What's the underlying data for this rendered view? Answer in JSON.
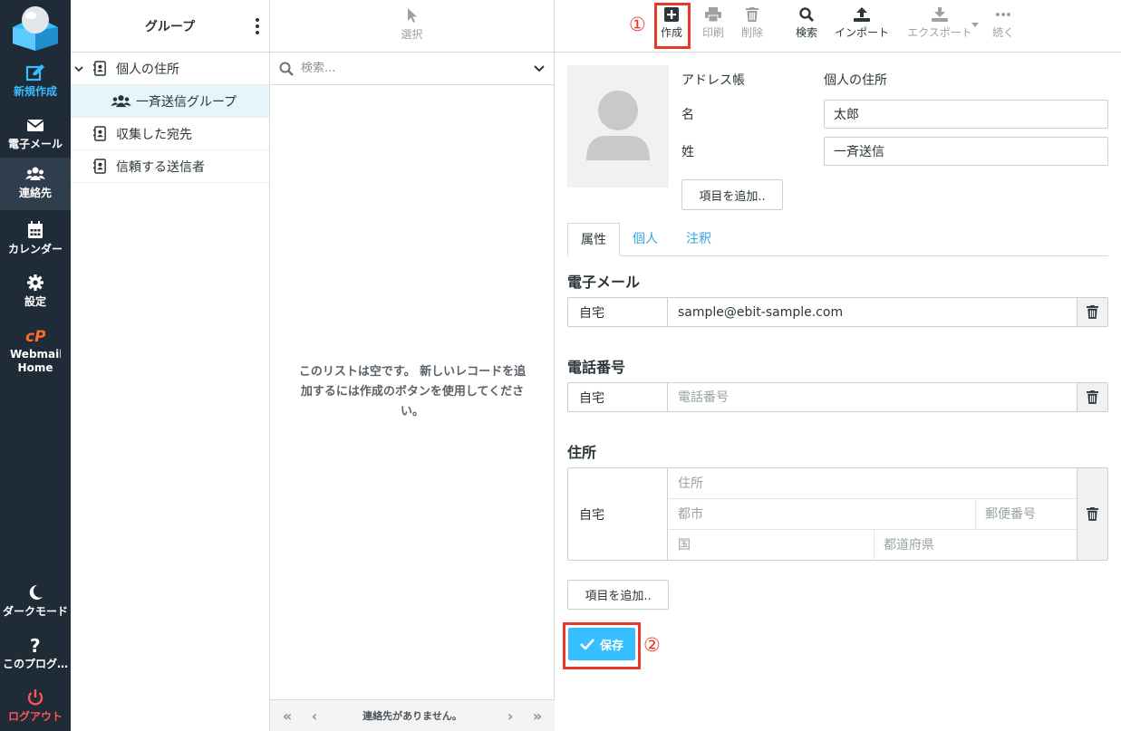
{
  "nav": {
    "items": [
      {
        "label": "新規作成",
        "icon": "compose-icon"
      },
      {
        "label": "電子メール",
        "icon": "envelope-icon"
      },
      {
        "label": "連絡先",
        "icon": "contacts-icon"
      },
      {
        "label": "カレンダー",
        "icon": "calendar-icon"
      },
      {
        "label": "設定",
        "icon": "gear-icon"
      },
      {
        "label": "Webmail Home",
        "icon": "cpanel-icon"
      }
    ],
    "bottom": [
      {
        "label": "ダークモード",
        "icon": "moon-icon"
      },
      {
        "label": "このプログ…",
        "icon": "question-icon"
      },
      {
        "label": "ログアウト",
        "icon": "power-icon"
      }
    ]
  },
  "groups": {
    "title": "グループ",
    "items": [
      {
        "label": "個人の住所"
      },
      {
        "label": "一斉送信グループ"
      },
      {
        "label": "収集した宛先"
      },
      {
        "label": "信頼する送信者"
      }
    ]
  },
  "list": {
    "select_label": "選択",
    "search_placeholder": "検索...",
    "empty_message": "このリストは空です。 新しいレコードを追加するには作成のボタンを使用してください。",
    "footer_status": "連絡先がありません。"
  },
  "toolbar": {
    "create": "作成",
    "print": "印刷",
    "delete": "削除",
    "search": "検索",
    "import": "インポート",
    "export": "エクスポート",
    "more": "続く",
    "marker1": "①",
    "marker2": "②"
  },
  "form": {
    "addressbook_label": "アドレス帳",
    "addressbook_value": "個人の住所",
    "firstname_label": "名",
    "firstname_value": "太郎",
    "lastname_label": "姓",
    "lastname_value": "一斉送信",
    "add_field": "項目を追加..",
    "tabs": [
      "属性",
      "個人",
      "注釈"
    ],
    "email_section": "電子メール",
    "email_type": "自宅",
    "email_value": "sample@ebit-sample.com",
    "phone_section": "電話番号",
    "phone_type": "自宅",
    "phone_placeholder": "電話番号",
    "address_section": "住所",
    "address_type": "自宅",
    "street_placeholder": "住所",
    "city_placeholder": "都市",
    "zip_placeholder": "郵便番号",
    "country_placeholder": "国",
    "region_placeholder": "都道府県",
    "add_field2": "項目を追加..",
    "save": "保存"
  },
  "colors": {
    "sidebar_bg": "#1f2b36",
    "accent": "#37beff",
    "highlight_red": "#e8382a"
  }
}
